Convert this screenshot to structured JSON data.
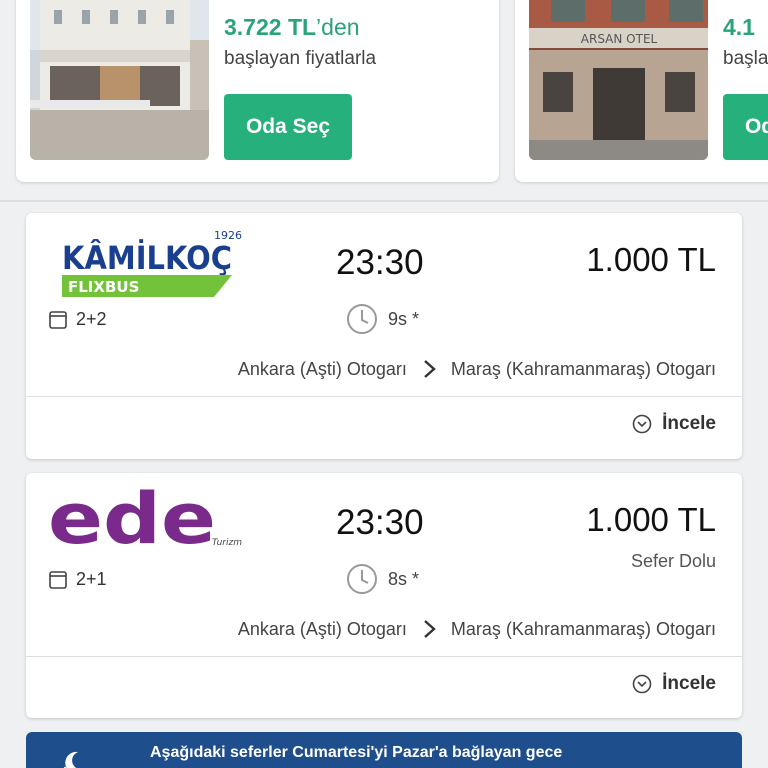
{
  "hotels": [
    {
      "price": "3.722 TL",
      "price_suffix": "’den",
      "sub": "başlayan fiyatlarla",
      "button": "Oda Seç"
    },
    {
      "price": "4.1",
      "price_suffix": "",
      "sub": "başla",
      "button": "Oda Seç",
      "image_sign": "ARSAN OTEL"
    }
  ],
  "trips": [
    {
      "logo_name": "KÂMİLKOÇ",
      "logo_year": "1926",
      "logo_sub": "FLIXBUS",
      "seat": "2+2",
      "time": "23:30",
      "duration": "9s *",
      "price": "1.000 TL",
      "status": "",
      "from": "Ankara (Aşti) Otogarı",
      "to": "Maraş (Kahramanmaraş) Otogarı",
      "action": "İncele"
    },
    {
      "logo_name": "ede",
      "logo_sub": "Turizm",
      "seat": "2+1",
      "time": "23:30",
      "duration": "8s *",
      "price": "1.000 TL",
      "status": "Sefer Dolu",
      "from": "Ankara (Aşti) Otogarı",
      "to": "Maraş (Kahramanmaraş) Otogarı",
      "action": "İncele"
    }
  ],
  "banner": {
    "text": "Aşağıdaki seferler Cumartesi'yi Pazar'a bağlayan gece"
  },
  "colors": {
    "green": "#25b07c",
    "price_green": "#2aa37a",
    "banner_blue": "#1e4e8c",
    "ede_purple": "#7a2a8a"
  }
}
